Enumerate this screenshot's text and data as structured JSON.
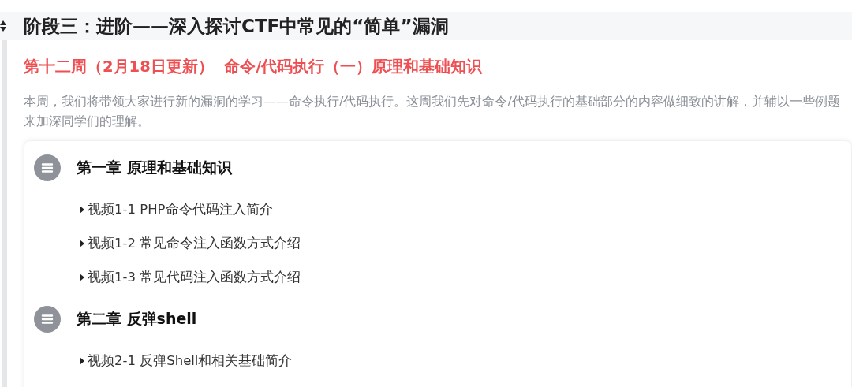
{
  "stage": {
    "title": "阶段三：进阶——深入探讨CTF中常见的“简单”漏洞"
  },
  "week": {
    "title": "第十二周（2月18日更新）  命令/代码执行（一）原理和基础知识",
    "description": "本周，我们将带领大家进行新的漏洞的学习——命令执行/代码执行。这周我们先对命令/代码执行的基础部分的内容做细致的讲解，并辅以一些例题来加深同学们的理解。"
  },
  "chapters": [
    {
      "title": "第一章 原理和基础知识",
      "lessons": [
        "视频1-1 PHP命令代码注入简介",
        "视频1-2 常见命令注入函数方式介绍",
        "视频1-3 常见代码注入函数方式介绍"
      ]
    },
    {
      "title": "第二章 反弹shell",
      "lessons": [
        "视频2-1 反弹Shell和相关基础简介"
      ]
    }
  ]
}
